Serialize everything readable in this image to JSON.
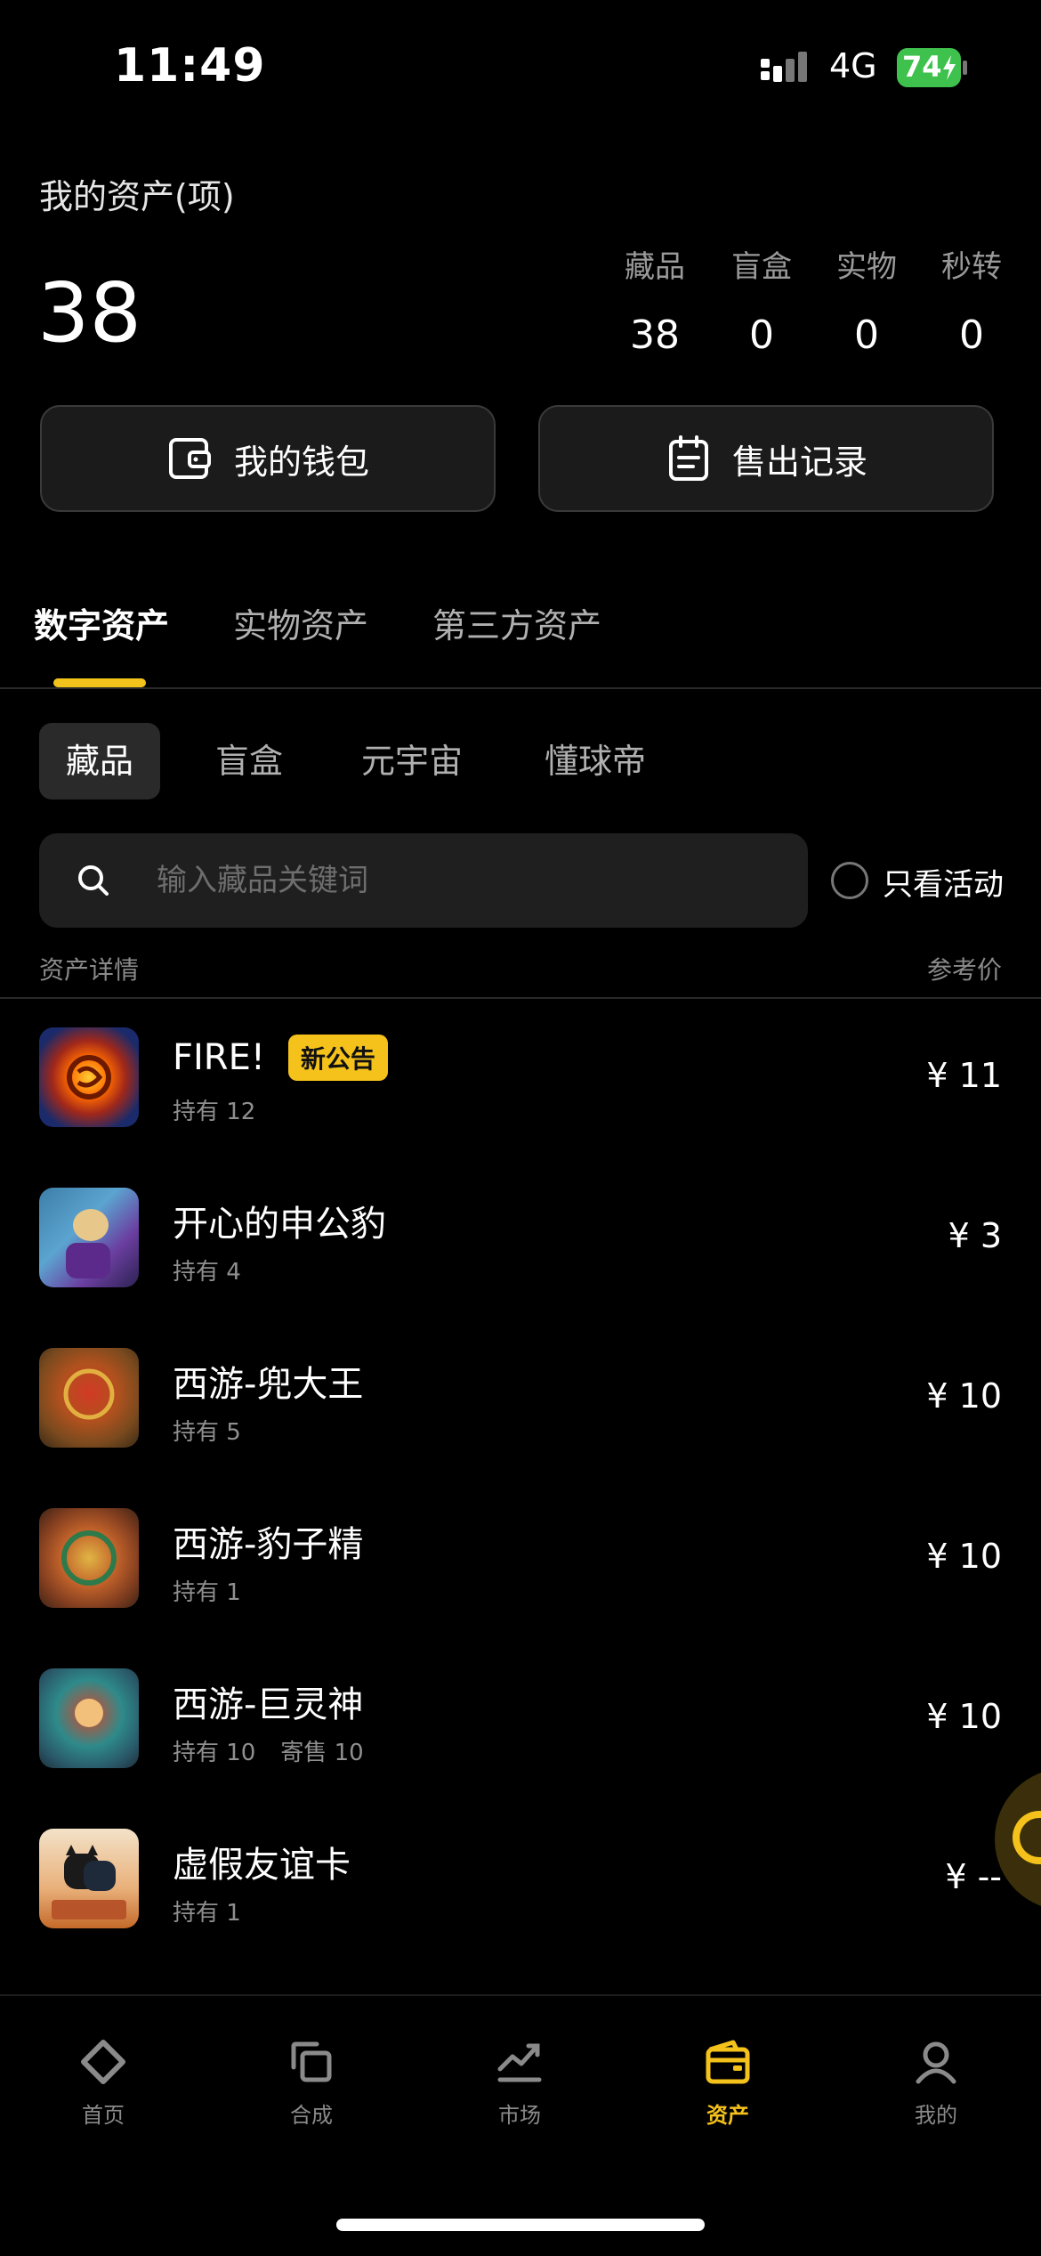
{
  "status_bar": {
    "time": "11:49",
    "network": "4G",
    "battery": "74"
  },
  "assets": {
    "title": "我的资产(项)",
    "total": "38",
    "stats": [
      {
        "label": "藏品",
        "value": "38"
      },
      {
        "label": "盲盒",
        "value": "0"
      },
      {
        "label": "实物",
        "value": "0"
      },
      {
        "label": "秒转",
        "value": "0"
      }
    ]
  },
  "actions": {
    "wallet": "我的钱包",
    "sales": "售出记录"
  },
  "tabs": [
    "数字资产",
    "实物资产",
    "第三方资产"
  ],
  "chips": [
    "藏品",
    "盲盒",
    "元宇宙",
    "懂球帝"
  ],
  "search": {
    "placeholder": "输入藏品关键词",
    "filter_label": "只看活动"
  },
  "list_header": {
    "left": "资产详情",
    "right": "参考价"
  },
  "items": [
    {
      "name": "FIRE!",
      "badge": "新公告",
      "hold": "持有 12",
      "consign": "",
      "price": "¥ 11"
    },
    {
      "name": "开心的申公豹",
      "badge": "",
      "hold": "持有 4",
      "consign": "",
      "price": "¥ 3"
    },
    {
      "name": "西游-兜大王",
      "badge": "",
      "hold": "持有 5",
      "consign": "",
      "price": "¥ 10"
    },
    {
      "name": "西游-豹子精",
      "badge": "",
      "hold": "持有 1",
      "consign": "",
      "price": "¥ 10"
    },
    {
      "name": "西游-巨灵神",
      "badge": "",
      "hold": "持有 10",
      "consign": "寄售 10",
      "price": "¥ 10"
    },
    {
      "name": "虚假友谊卡",
      "badge": "",
      "hold": "持有 1",
      "consign": "",
      "price": "¥ --"
    }
  ],
  "nav": [
    {
      "label": "首页",
      "icon": "home-diamond-icon"
    },
    {
      "label": "合成",
      "icon": "merge-icon"
    },
    {
      "label": "市场",
      "icon": "trend-chart-icon"
    },
    {
      "label": "资产",
      "icon": "wallet-icon",
      "active": true
    },
    {
      "label": "我的",
      "icon": "user-icon"
    }
  ],
  "colors": {
    "accent": "#f5c21b",
    "background": "#000000",
    "card": "#1b1b1b"
  }
}
